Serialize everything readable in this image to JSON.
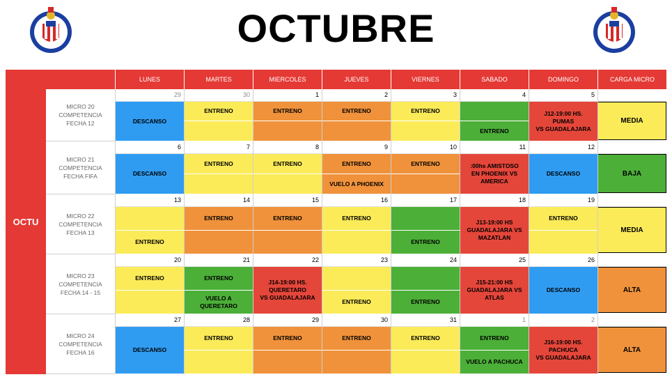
{
  "title": "OCTUBRE",
  "month_label": "OCTU",
  "colors": {
    "red": "#e5463a",
    "blue": "#2f9cf2",
    "yellow": "#fbeb59",
    "orange": "#f0923b",
    "green": "#4caf38"
  },
  "days": [
    "LUNES",
    "MARTES",
    "MIERCOLES",
    "JUEVES",
    "VIERNES",
    "SABADO",
    "DOMINGO",
    "CARGA MICRO"
  ],
  "weeks": [
    {
      "label": "MICRO 20\nCOMPETENCIA\nFECHA 12",
      "nums": [
        "29",
        "30",
        "1",
        "2",
        "3",
        "4",
        "5"
      ],
      "carga": "MEDIA",
      "cells": [
        {
          "top": {
            "c": "blue",
            "t": "DESCANSO",
            "merge": true
          }
        },
        {
          "top": {
            "c": "yellow",
            "t": "ENTRENO"
          },
          "bot": {
            "c": "yellow",
            "t": ""
          }
        },
        {
          "top": {
            "c": "orange",
            "t": "ENTRENO"
          },
          "bot": {
            "c": "orange",
            "t": ""
          }
        },
        {
          "top": {
            "c": "orange",
            "t": "ENTRENO"
          },
          "bot": {
            "c": "orange",
            "t": ""
          }
        },
        {
          "top": {
            "c": "yellow",
            "t": "ENTRENO"
          },
          "bot": {
            "c": "yellow",
            "t": ""
          }
        },
        {
          "top": {
            "c": "green",
            "t": ""
          },
          "bot": {
            "c": "green",
            "t": "ENTRENO"
          }
        },
        {
          "top": {
            "c": "red",
            "t": "J12-19:00 HS.\nPUMAS\nVS GUADALAJARA",
            "merge": true
          }
        }
      ]
    },
    {
      "label": "MICRO 21\nCOMPETENCIA\nFECHA FIFA",
      "nums": [
        "6",
        "7",
        "8",
        "9",
        "10",
        "11",
        "12"
      ],
      "carga": "BAJA",
      "cells": [
        {
          "top": {
            "c": "blue",
            "t": "DESCANSO",
            "merge": true
          }
        },
        {
          "top": {
            "c": "yellow",
            "t": "ENTRENO"
          },
          "bot": {
            "c": "yellow",
            "t": ""
          }
        },
        {
          "top": {
            "c": "yellow",
            "t": "ENTRENO"
          },
          "bot": {
            "c": "yellow",
            "t": ""
          }
        },
        {
          "top": {
            "c": "orange",
            "t": "ENTRENO"
          },
          "bot": {
            "c": "orange",
            "t": "VUELO A PHOENIX"
          }
        },
        {
          "top": {
            "c": "orange",
            "t": "ENTRENO"
          },
          "bot": {
            "c": "orange",
            "t": ""
          }
        },
        {
          "top": {
            "c": "red",
            "t": ":00hs AMISTOSO\nEN PHOENIX VS\nAMERICA",
            "merge": true
          }
        },
        {
          "top": {
            "c": "blue",
            "t": "DESCANSO",
            "merge": true
          }
        }
      ]
    },
    {
      "label": "MICRO 22\nCOMPETENCIA\nFECHA 13",
      "nums": [
        "13",
        "14",
        "15",
        "16",
        "17",
        "18",
        "19"
      ],
      "carga": "MEDIA",
      "cells": [
        {
          "top": {
            "c": "yellow",
            "t": ""
          },
          "bot": {
            "c": "yellow",
            "t": "ENTRENO"
          }
        },
        {
          "top": {
            "c": "orange",
            "t": "ENTRENO"
          },
          "bot": {
            "c": "orange",
            "t": ""
          }
        },
        {
          "top": {
            "c": "orange",
            "t": "ENTRENO"
          },
          "bot": {
            "c": "orange",
            "t": ""
          }
        },
        {
          "top": {
            "c": "yellow",
            "t": "ENTRENO"
          },
          "bot": {
            "c": "yellow",
            "t": ""
          }
        },
        {
          "top": {
            "c": "green",
            "t": ""
          },
          "bot": {
            "c": "green",
            "t": "ENTRENO"
          }
        },
        {
          "top": {
            "c": "red",
            "t": "J13-19:00 HS\nGUADALAJARA VS\nMAZATLAN",
            "merge": true
          }
        },
        {
          "top": {
            "c": "yellow",
            "t": "ENTRENO"
          },
          "bot": {
            "c": "yellow",
            "t": ""
          }
        }
      ]
    },
    {
      "label": "MICRO 23\nCOMPETENCIA\nFECHA 14 - 15",
      "nums": [
        "20",
        "21",
        "22",
        "23",
        "24",
        "25",
        "26"
      ],
      "carga": "ALTA",
      "cells": [
        {
          "top": {
            "c": "yellow",
            "t": "ENTRENO"
          },
          "bot": {
            "c": "yellow",
            "t": ""
          }
        },
        {
          "top": {
            "c": "green",
            "t": "ENTRENO"
          },
          "bot": {
            "c": "green",
            "t": "VUELO A\nQUERETARO"
          }
        },
        {
          "top": {
            "c": "red",
            "t": "J14-19:00 HS.\nQUERETARO\nVS GUADALAJARA",
            "merge": true
          }
        },
        {
          "top": {
            "c": "yellow",
            "t": ""
          },
          "bot": {
            "c": "yellow",
            "t": "ENTRENO"
          }
        },
        {
          "top": {
            "c": "green",
            "t": ""
          },
          "bot": {
            "c": "green",
            "t": "ENTRENO"
          }
        },
        {
          "top": {
            "c": "red",
            "t": "J15-21:00 HS\nGUADALAJARA VS\nATLAS",
            "merge": true
          }
        },
        {
          "top": {
            "c": "blue",
            "t": "DESCANSO",
            "merge": true
          }
        }
      ]
    },
    {
      "label": "MICRO 24\nCOMPETENCIA\nFECHA 16",
      "nums": [
        "27",
        "28",
        "29",
        "30",
        "31",
        "1",
        "2"
      ],
      "carga": "ALTA",
      "cells": [
        {
          "top": {
            "c": "blue",
            "t": "DESCANSO",
            "merge": true
          }
        },
        {
          "top": {
            "c": "yellow",
            "t": "ENTRENO"
          },
          "bot": {
            "c": "yellow",
            "t": ""
          }
        },
        {
          "top": {
            "c": "orange",
            "t": "ENTRENO"
          },
          "bot": {
            "c": "orange",
            "t": ""
          }
        },
        {
          "top": {
            "c": "orange",
            "t": "ENTRENO"
          },
          "bot": {
            "c": "orange",
            "t": ""
          }
        },
        {
          "top": {
            "c": "yellow",
            "t": "ENTRENO"
          },
          "bot": {
            "c": "yellow",
            "t": ""
          }
        },
        {
          "top": {
            "c": "green",
            "t": "ENTRENO"
          },
          "bot": {
            "c": "green",
            "t": "VUELO A PACHUCA"
          }
        },
        {
          "top": {
            "c": "red",
            "t": "J16-19:00 HS.\nPACHUCA\nVS GUADALAJARA",
            "merge": true
          }
        }
      ]
    }
  ]
}
